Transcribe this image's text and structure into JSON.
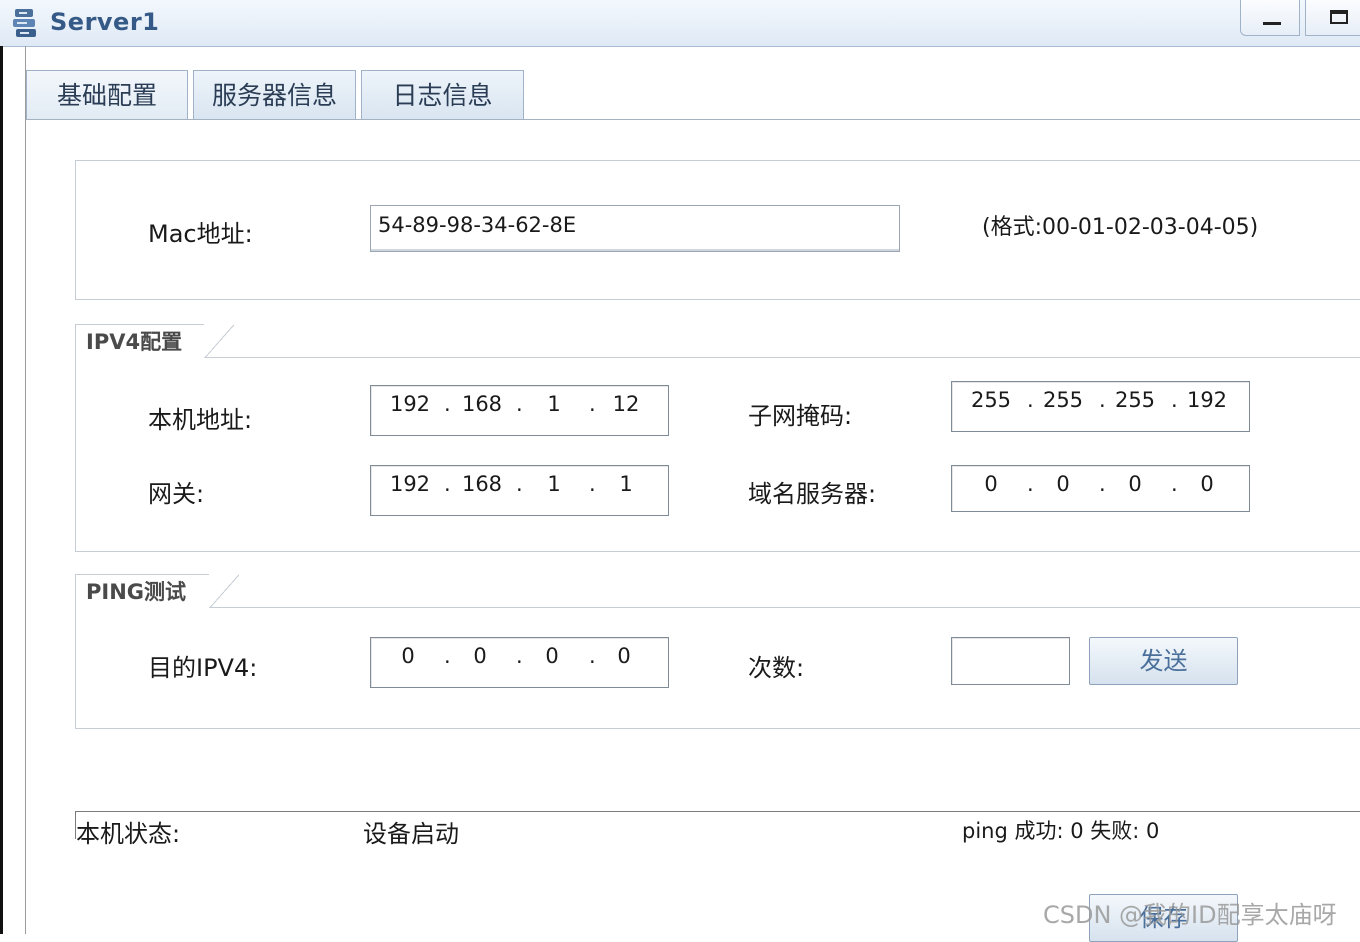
{
  "window": {
    "title": "Server1",
    "icon": "server-icon",
    "controls": [
      "minimize-icon",
      "maximize-icon"
    ]
  },
  "tabs": [
    {
      "label": "基础配置",
      "active": true
    },
    {
      "label": "服务器信息",
      "active": false
    },
    {
      "label": "日志信息",
      "active": false
    }
  ],
  "mac": {
    "label": "Mac地址:",
    "value": "54-89-98-34-62-8E",
    "hint": "(格式:00-01-02-03-04-05)"
  },
  "ipv4": {
    "group_title": "IPV4配置",
    "host": {
      "label": "本机地址:",
      "octets": [
        "192",
        "168",
        "1",
        "12"
      ]
    },
    "mask": {
      "label": "子网掩码:",
      "octets": [
        "255",
        "255",
        "255",
        "192"
      ]
    },
    "gateway": {
      "label": "网关:",
      "octets": [
        "192",
        "168",
        "1",
        "1"
      ]
    },
    "dns": {
      "label": "域名服务器:",
      "octets": [
        "0",
        "0",
        "0",
        "0"
      ]
    }
  },
  "ping": {
    "group_title": "PING测试",
    "dest": {
      "label": "目的IPV4:",
      "octets": [
        "0",
        "0",
        "0",
        "0"
      ]
    },
    "count": {
      "label": "次数:",
      "value": ""
    },
    "send_label": "发送"
  },
  "status": {
    "label": "本机状态:",
    "value": "设备启动",
    "ping_result": "ping 成功: 0 失败: 0"
  },
  "save_label": "保存",
  "watermark": "CSDN @我的ID配享太庙呀",
  "colors": {
    "titlebar": "#dfe9f5",
    "title_text": "#355a87",
    "button_text": "#4a6f9a",
    "border": "#7f8b97"
  }
}
